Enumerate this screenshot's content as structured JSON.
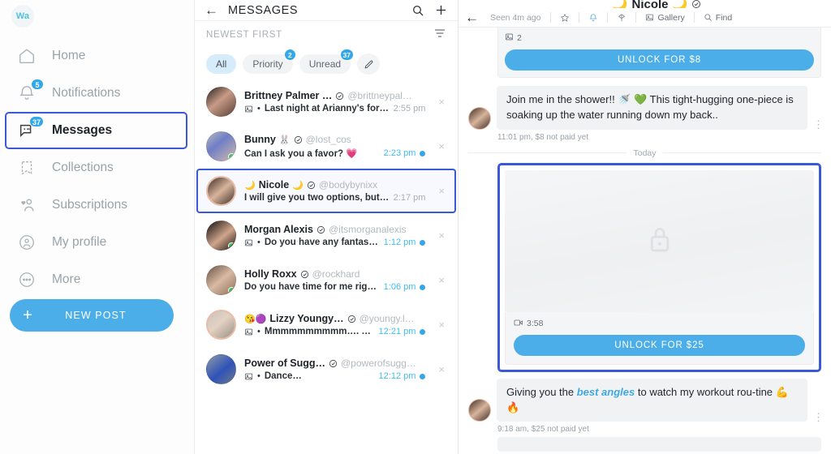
{
  "sidebar": {
    "logo_label": "Wa",
    "items": [
      {
        "label": "Home",
        "icon": "home-icon",
        "badge": ""
      },
      {
        "label": "Notifications",
        "icon": "bell-icon",
        "badge": "5"
      },
      {
        "label": "Messages",
        "icon": "chat-bubble-icon",
        "badge": "37"
      },
      {
        "label": "Collections",
        "icon": "bookmark-icon",
        "badge": ""
      },
      {
        "label": "Subscriptions",
        "icon": "user-heart-icon",
        "badge": ""
      },
      {
        "label": "My profile",
        "icon": "profile-circle-icon",
        "badge": ""
      },
      {
        "label": "More",
        "icon": "ellipsis-circle-icon",
        "badge": ""
      }
    ],
    "new_post_label": "NEW POST"
  },
  "messages_panel": {
    "title": "MESSAGES",
    "sort_label": "NEWEST FIRST",
    "chips": [
      {
        "label": "All",
        "badge": ""
      },
      {
        "label": "Priority",
        "badge": "2"
      },
      {
        "label": "Unread",
        "badge": "37"
      }
    ],
    "rows": [
      {
        "name": "Brittney Palmer …",
        "prefix_emoji": "",
        "handle": "@brittneypal…",
        "preview": "Last night at Arianny's for me …",
        "has_media": true,
        "time": "2:55 pm",
        "unread": false,
        "online": false,
        "selected": false
      },
      {
        "name": "Bunny",
        "prefix_emoji": "",
        "name_suffix_emoji": "🐰",
        "handle": "@lost_cos",
        "preview": "Can I ask you a favor? 💗",
        "has_media": false,
        "time": "2:23 pm",
        "unread": true,
        "online": true,
        "selected": false
      },
      {
        "name": "Nicole",
        "prefix_emoji": "🌙",
        "name_suffix_emoji": "🌙",
        "handle": "@bodybynixx",
        "preview": "I will give you two options, but you …",
        "has_media": false,
        "time": "2:17 pm",
        "unread": false,
        "online": false,
        "selected": true
      },
      {
        "name": "Morgan Alexis",
        "prefix_emoji": "",
        "handle": "@itsmorganalexis",
        "preview": "Do you have any fantasies w…",
        "has_media": true,
        "time": "1:12 pm",
        "unread": true,
        "online": true,
        "selected": false
      },
      {
        "name": "Holly Roxx",
        "prefix_emoji": "",
        "handle": "@rockhard",
        "preview": "Do you have time for me right no…",
        "has_media": false,
        "time": "1:06 pm",
        "unread": true,
        "online": true,
        "selected": false
      },
      {
        "name": "Lizzy Youngy…",
        "prefix_emoji": "😘🟣",
        "handle": "@youngy.l…",
        "preview": "Mmmmmmmmmm…. my s…",
        "has_media": true,
        "time": "12:21 pm",
        "unread": true,
        "online": false,
        "selected": false
      },
      {
        "name": "Power of Sugg…",
        "prefix_emoji": "",
        "handle": "@powerofsugg…",
        "preview": "Dance…",
        "has_media": true,
        "time": "12:12 pm",
        "unread": true,
        "online": false,
        "selected": false
      }
    ]
  },
  "chat": {
    "contact_name": "Nicole",
    "contact_emoji_left": "🌙",
    "contact_emoji_right": "🌙",
    "seen_text": "Seen 4m ago",
    "actions": [
      {
        "label": "",
        "icon": "star-icon"
      },
      {
        "label": "",
        "icon": "bell-icon"
      },
      {
        "label": "",
        "icon": "pin-icon"
      },
      {
        "label": "Gallery",
        "icon": "gallery-icon"
      },
      {
        "label": "Find",
        "icon": "search-icon"
      }
    ],
    "top_media": {
      "count_label": "2",
      "icon": "photo-icon",
      "unlock_label": "UNLOCK FOR $8"
    },
    "messages": [
      {
        "text_plain": "Join me in the shower!! 🚿 💚 This tight-hugging one-piece is soaking up the water running down my back..",
        "meta": "11:01 pm,  $8 not paid yet"
      }
    ],
    "day_separator": "Today",
    "locked_media": {
      "duration_icon": "video-icon",
      "duration_label": "3:58",
      "unlock_label": "UNLOCK FOR $25",
      "lock_icon": "lock-icon"
    },
    "bottom_message": {
      "part1": "Giving you the ",
      "highlight": "best angles",
      "part2": " to watch my workout rou-tine 💪 🔥",
      "meta": "9:18 am,  $25 not paid yet"
    }
  },
  "colors": {
    "accent_blue": "#4caee8",
    "highlight_border": "#3b58d6",
    "badge_blue": "#33a8e8",
    "online_green": "#36c457",
    "muted_text": "#9aa1a8"
  }
}
